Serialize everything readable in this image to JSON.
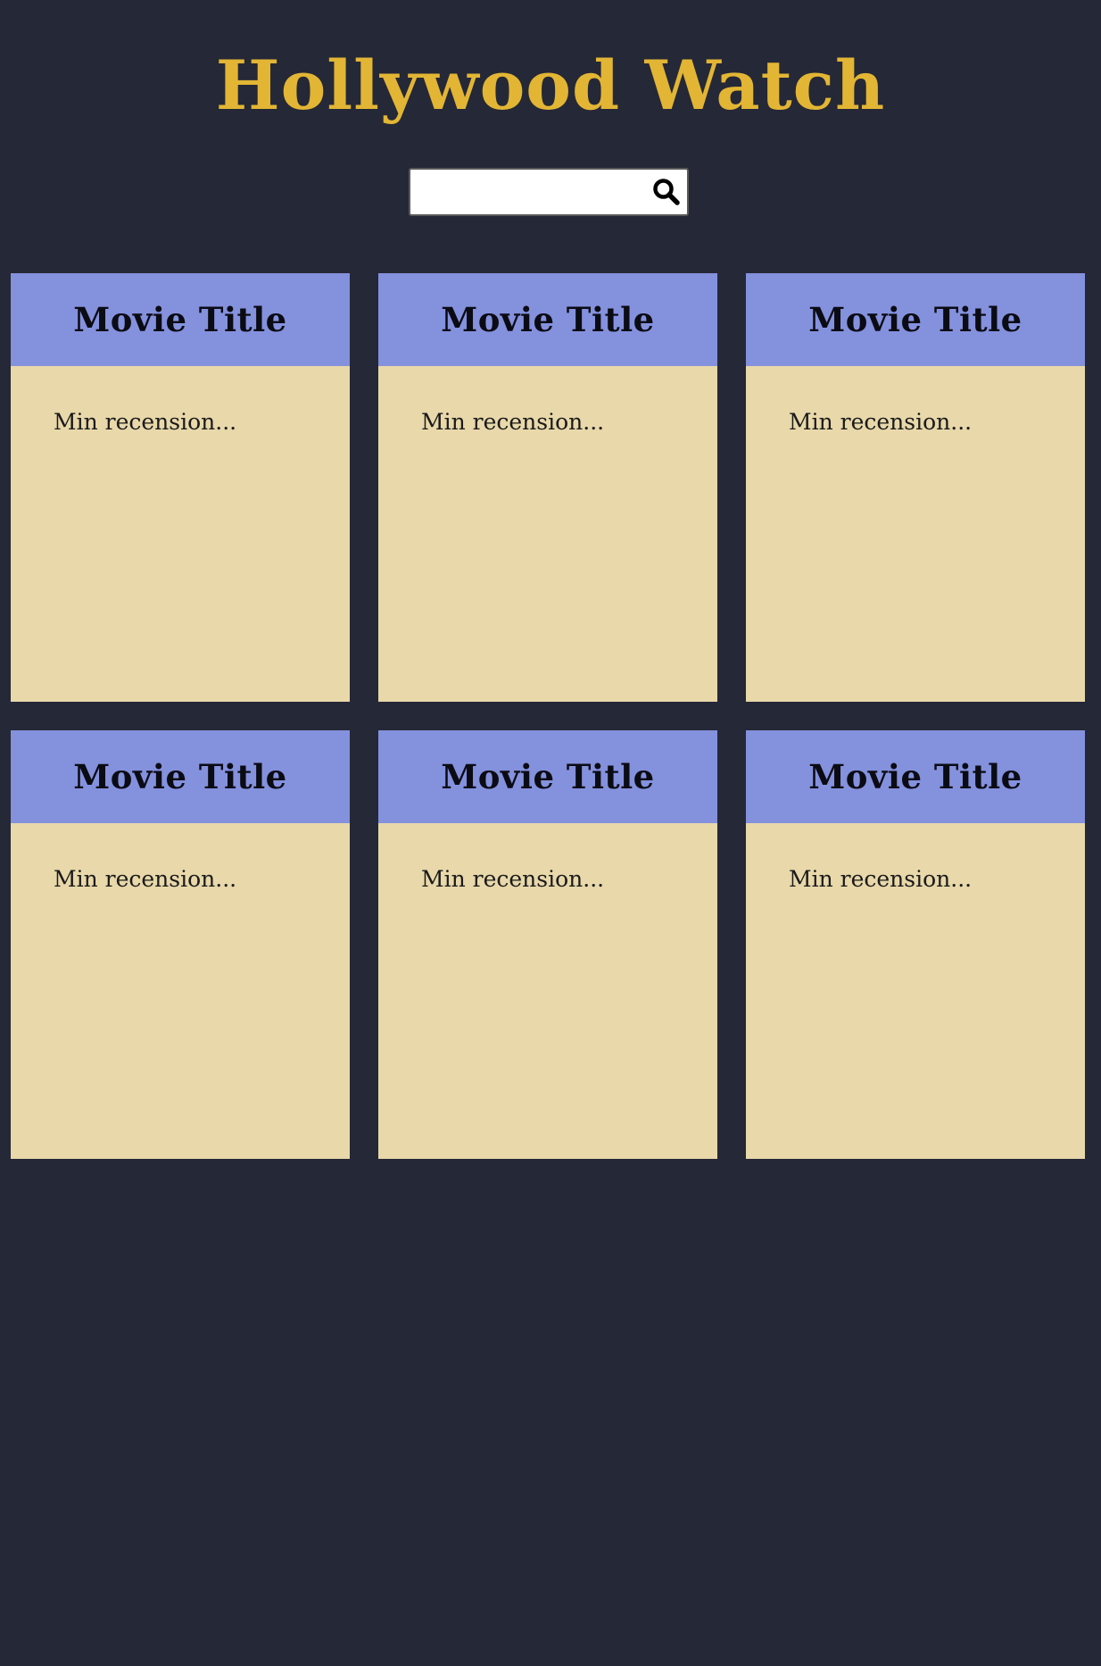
{
  "header": {
    "title": "Hollywood Watch"
  },
  "search": {
    "value": "",
    "placeholder": "",
    "icon": "search-icon"
  },
  "colors": {
    "background": "#252836",
    "title": "#E2B534",
    "card_header": "#8491DD",
    "card_body": "#E8D8AA"
  },
  "movies": [
    {
      "title": "Movie Title",
      "review": "Min recension..."
    },
    {
      "title": "Movie Title",
      "review": "Min recension..."
    },
    {
      "title": "Movie Title",
      "review": "Min recension..."
    },
    {
      "title": "Movie Title",
      "review": "Min recension..."
    },
    {
      "title": "Movie Title",
      "review": "Min recension..."
    },
    {
      "title": "Movie Title",
      "review": "Min recension..."
    }
  ]
}
